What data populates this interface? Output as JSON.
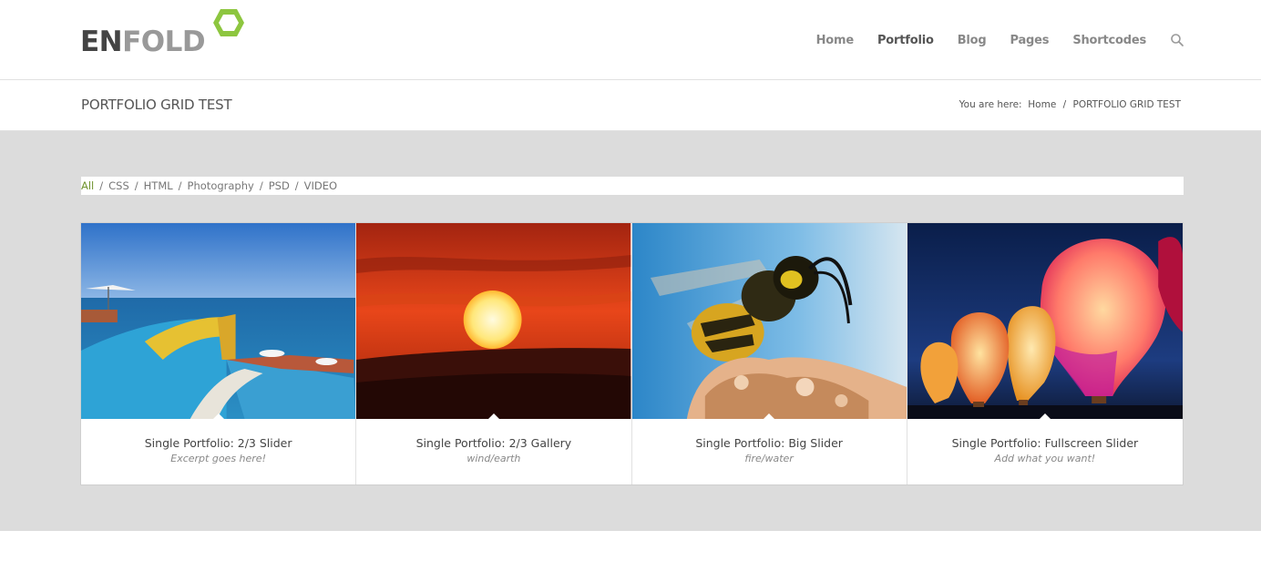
{
  "header": {
    "logo": {
      "part1": "EN",
      "part2": "FOLD",
      "accent_color": "#8dc63f"
    },
    "nav": [
      {
        "label": "Home",
        "active": false
      },
      {
        "label": "Portfolio",
        "active": true
      },
      {
        "label": "Blog",
        "active": false
      },
      {
        "label": "Pages",
        "active": false
      },
      {
        "label": "Shortcodes",
        "active": false
      }
    ],
    "search_icon": "search-icon"
  },
  "titlebar": {
    "title": "PORTFOLIO GRID TEST",
    "breadcrumb": {
      "prefix": "You are here:",
      "home": "Home",
      "separator": "/",
      "current": "PORTFOLIO GRID TEST"
    }
  },
  "filters": {
    "items": [
      "All",
      "CSS",
      "HTML",
      "Photography",
      "PSD",
      "VIDEO"
    ],
    "separator": "/",
    "active_color": "#719430"
  },
  "portfolio": [
    {
      "title": "Single Portfolio: 2/3 Slider",
      "excerpt": "Excerpt goes here!",
      "image": "resort-pool-ocean"
    },
    {
      "title": "Single Portfolio: 2/3 Gallery",
      "excerpt": "wind/earth",
      "image": "sunset-sun"
    },
    {
      "title": "Single Portfolio: Big Slider",
      "excerpt": "fire/water",
      "image": "wasp-closeup"
    },
    {
      "title": "Single Portfolio: Fullscreen Slider",
      "excerpt": "Add what you want!",
      "image": "hot-air-balloons"
    }
  ],
  "colors": {
    "background_gray": "#dcdcdc",
    "text": "#666666"
  }
}
